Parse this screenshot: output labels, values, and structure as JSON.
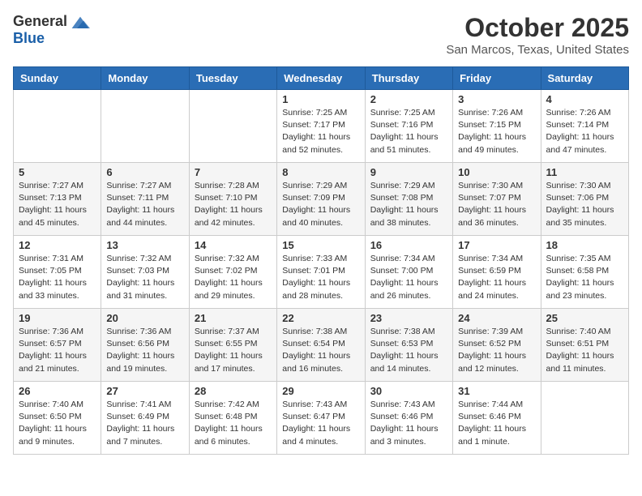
{
  "header": {
    "logo_general": "General",
    "logo_blue": "Blue",
    "month_title": "October 2025",
    "location": "San Marcos, Texas, United States"
  },
  "weekdays": [
    "Sunday",
    "Monday",
    "Tuesday",
    "Wednesday",
    "Thursday",
    "Friday",
    "Saturday"
  ],
  "weeks": [
    [
      {
        "day": "",
        "info": ""
      },
      {
        "day": "",
        "info": ""
      },
      {
        "day": "",
        "info": ""
      },
      {
        "day": "1",
        "info": "Sunrise: 7:25 AM\nSunset: 7:17 PM\nDaylight: 11 hours\nand 52 minutes."
      },
      {
        "day": "2",
        "info": "Sunrise: 7:25 AM\nSunset: 7:16 PM\nDaylight: 11 hours\nand 51 minutes."
      },
      {
        "day": "3",
        "info": "Sunrise: 7:26 AM\nSunset: 7:15 PM\nDaylight: 11 hours\nand 49 minutes."
      },
      {
        "day": "4",
        "info": "Sunrise: 7:26 AM\nSunset: 7:14 PM\nDaylight: 11 hours\nand 47 minutes."
      }
    ],
    [
      {
        "day": "5",
        "info": "Sunrise: 7:27 AM\nSunset: 7:13 PM\nDaylight: 11 hours\nand 45 minutes."
      },
      {
        "day": "6",
        "info": "Sunrise: 7:27 AM\nSunset: 7:11 PM\nDaylight: 11 hours\nand 44 minutes."
      },
      {
        "day": "7",
        "info": "Sunrise: 7:28 AM\nSunset: 7:10 PM\nDaylight: 11 hours\nand 42 minutes."
      },
      {
        "day": "8",
        "info": "Sunrise: 7:29 AM\nSunset: 7:09 PM\nDaylight: 11 hours\nand 40 minutes."
      },
      {
        "day": "9",
        "info": "Sunrise: 7:29 AM\nSunset: 7:08 PM\nDaylight: 11 hours\nand 38 minutes."
      },
      {
        "day": "10",
        "info": "Sunrise: 7:30 AM\nSunset: 7:07 PM\nDaylight: 11 hours\nand 36 minutes."
      },
      {
        "day": "11",
        "info": "Sunrise: 7:30 AM\nSunset: 7:06 PM\nDaylight: 11 hours\nand 35 minutes."
      }
    ],
    [
      {
        "day": "12",
        "info": "Sunrise: 7:31 AM\nSunset: 7:05 PM\nDaylight: 11 hours\nand 33 minutes."
      },
      {
        "day": "13",
        "info": "Sunrise: 7:32 AM\nSunset: 7:03 PM\nDaylight: 11 hours\nand 31 minutes."
      },
      {
        "day": "14",
        "info": "Sunrise: 7:32 AM\nSunset: 7:02 PM\nDaylight: 11 hours\nand 29 minutes."
      },
      {
        "day": "15",
        "info": "Sunrise: 7:33 AM\nSunset: 7:01 PM\nDaylight: 11 hours\nand 28 minutes."
      },
      {
        "day": "16",
        "info": "Sunrise: 7:34 AM\nSunset: 7:00 PM\nDaylight: 11 hours\nand 26 minutes."
      },
      {
        "day": "17",
        "info": "Sunrise: 7:34 AM\nSunset: 6:59 PM\nDaylight: 11 hours\nand 24 minutes."
      },
      {
        "day": "18",
        "info": "Sunrise: 7:35 AM\nSunset: 6:58 PM\nDaylight: 11 hours\nand 23 minutes."
      }
    ],
    [
      {
        "day": "19",
        "info": "Sunrise: 7:36 AM\nSunset: 6:57 PM\nDaylight: 11 hours\nand 21 minutes."
      },
      {
        "day": "20",
        "info": "Sunrise: 7:36 AM\nSunset: 6:56 PM\nDaylight: 11 hours\nand 19 minutes."
      },
      {
        "day": "21",
        "info": "Sunrise: 7:37 AM\nSunset: 6:55 PM\nDaylight: 11 hours\nand 17 minutes."
      },
      {
        "day": "22",
        "info": "Sunrise: 7:38 AM\nSunset: 6:54 PM\nDaylight: 11 hours\nand 16 minutes."
      },
      {
        "day": "23",
        "info": "Sunrise: 7:38 AM\nSunset: 6:53 PM\nDaylight: 11 hours\nand 14 minutes."
      },
      {
        "day": "24",
        "info": "Sunrise: 7:39 AM\nSunset: 6:52 PM\nDaylight: 11 hours\nand 12 minutes."
      },
      {
        "day": "25",
        "info": "Sunrise: 7:40 AM\nSunset: 6:51 PM\nDaylight: 11 hours\nand 11 minutes."
      }
    ],
    [
      {
        "day": "26",
        "info": "Sunrise: 7:40 AM\nSunset: 6:50 PM\nDaylight: 11 hours\nand 9 minutes."
      },
      {
        "day": "27",
        "info": "Sunrise: 7:41 AM\nSunset: 6:49 PM\nDaylight: 11 hours\nand 7 minutes."
      },
      {
        "day": "28",
        "info": "Sunrise: 7:42 AM\nSunset: 6:48 PM\nDaylight: 11 hours\nand 6 minutes."
      },
      {
        "day": "29",
        "info": "Sunrise: 7:43 AM\nSunset: 6:47 PM\nDaylight: 11 hours\nand 4 minutes."
      },
      {
        "day": "30",
        "info": "Sunrise: 7:43 AM\nSunset: 6:46 PM\nDaylight: 11 hours\nand 3 minutes."
      },
      {
        "day": "31",
        "info": "Sunrise: 7:44 AM\nSunset: 6:46 PM\nDaylight: 11 hours\nand 1 minute."
      },
      {
        "day": "",
        "info": ""
      }
    ]
  ]
}
